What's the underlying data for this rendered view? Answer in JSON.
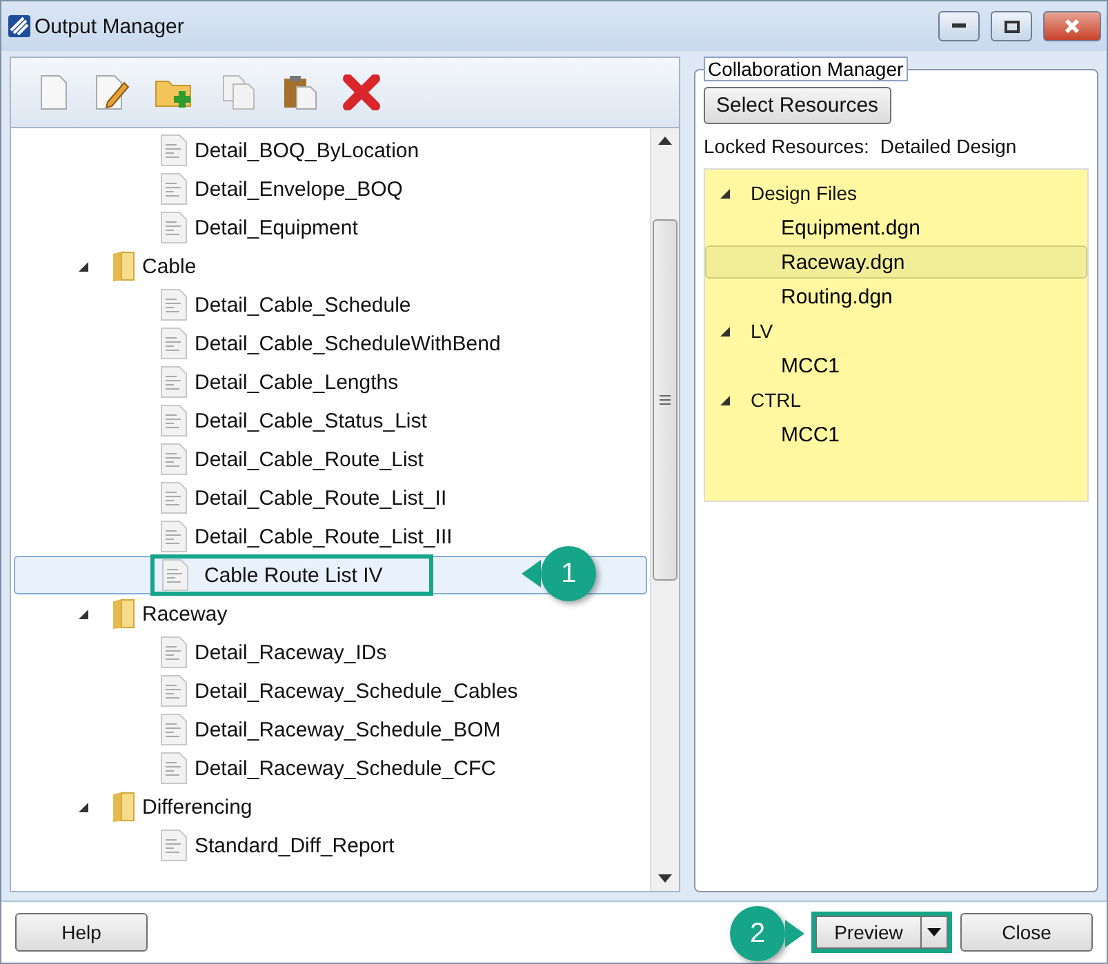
{
  "window": {
    "title": "Output Manager"
  },
  "tree": {
    "items": [
      {
        "label": "Detail_BOQ_ByLocation",
        "kind": "report",
        "selected": false
      },
      {
        "label": "Detail_Envelope_BOQ",
        "kind": "report",
        "selected": false
      },
      {
        "label": "Detail_Equipment",
        "kind": "report",
        "selected": false
      },
      {
        "label": "Cable",
        "kind": "folder",
        "expanded": true,
        "selected": false,
        "children": [
          {
            "label": "Detail_Cable_Schedule",
            "kind": "report",
            "selected": false
          },
          {
            "label": "Detail_Cable_ScheduleWithBend",
            "kind": "report",
            "selected": false
          },
          {
            "label": "Detail_Cable_Lengths",
            "kind": "report",
            "selected": false
          },
          {
            "label": "Detail_Cable_Status_List",
            "kind": "report",
            "selected": false
          },
          {
            "label": "Detail_Cable_Route_List",
            "kind": "report",
            "selected": false
          },
          {
            "label": "Detail_Cable_Route_List_II",
            "kind": "report",
            "selected": false
          },
          {
            "label": "Detail_Cable_Route_List_III",
            "kind": "report",
            "selected": false
          },
          {
            "label": "Cable Route List IV",
            "kind": "report",
            "selected": true,
            "callout": "1"
          }
        ]
      },
      {
        "label": "Raceway",
        "kind": "folder",
        "expanded": true,
        "selected": false,
        "children": [
          {
            "label": "Detail_Raceway_IDs",
            "kind": "report",
            "selected": false
          },
          {
            "label": "Detail_Raceway_Schedule_Cables",
            "kind": "report",
            "selected": false
          },
          {
            "label": "Detail_Raceway_Schedule_BOM",
            "kind": "report",
            "selected": false
          },
          {
            "label": "Detail_Raceway_Schedule_CFC",
            "kind": "report",
            "selected": false
          }
        ]
      },
      {
        "label": "Differencing",
        "kind": "folder",
        "expanded": true,
        "selected": false,
        "children": [
          {
            "label": "Standard_Diff_Report",
            "kind": "report",
            "selected": false
          }
        ]
      }
    ]
  },
  "collaboration": {
    "title": "Collaboration Manager",
    "button": "Select Resources",
    "locked_label": "Locked Resources:",
    "locked_value": "Detailed Design",
    "resources": [
      {
        "label": "Design Files",
        "expanded": true,
        "children": [
          {
            "label": "Equipment.dgn",
            "selected": false
          },
          {
            "label": "Raceway.dgn",
            "selected": true
          },
          {
            "label": "Routing.dgn",
            "selected": false
          }
        ]
      },
      {
        "label": "LV",
        "expanded": true,
        "children": [
          {
            "label": "MCC1",
            "selected": false
          }
        ]
      },
      {
        "label": "CTRL",
        "expanded": true,
        "children": [
          {
            "label": "MCC1",
            "selected": false
          }
        ]
      }
    ]
  },
  "footer": {
    "help": "Help",
    "preview": "Preview",
    "preview_callout": "2",
    "close": "Close"
  }
}
